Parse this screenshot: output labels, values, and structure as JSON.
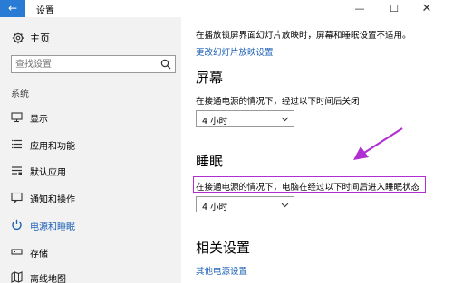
{
  "window": {
    "back_icon": "back-arrow-icon",
    "back_glyph": "←",
    "title": "设置",
    "min_glyph": "—",
    "max_glyph": "☐",
    "close_glyph": "✕"
  },
  "sidebar": {
    "home_label": "主页",
    "search_placeholder": "查找设置",
    "section_label": "系统",
    "items": [
      {
        "label": "显示",
        "icon": "display-icon"
      },
      {
        "label": "应用和功能",
        "icon": "apps-list-icon"
      },
      {
        "label": "默认应用",
        "icon": "default-apps-icon"
      },
      {
        "label": "通知和操作",
        "icon": "notification-icon"
      },
      {
        "label": "电源和睡眠",
        "icon": "power-icon",
        "active": true
      },
      {
        "label": "存储",
        "icon": "storage-icon"
      },
      {
        "label": "离线地图",
        "icon": "offline-maps-icon"
      }
    ]
  },
  "main": {
    "note": "在播放锁屏界面幻灯片放映时，屏幕和睡眠设置不适用。",
    "slideshow_link": "更改幻灯片放映设置",
    "screen": {
      "heading": "屏幕",
      "desc": "在接通电源的情况下，经过以下时间后关闭",
      "value": "4 小时"
    },
    "sleep": {
      "heading": "睡眠",
      "desc": "在接通电源的情况下，电脑在经过以下时间后进入睡眠状态",
      "value": "4 小时"
    },
    "related": {
      "heading": "相关设置",
      "link": "其他电源设置"
    }
  },
  "colors": {
    "accent": "#1a5fb4",
    "back_button": "#2a7bd4",
    "annotation": "#b12fd2"
  }
}
